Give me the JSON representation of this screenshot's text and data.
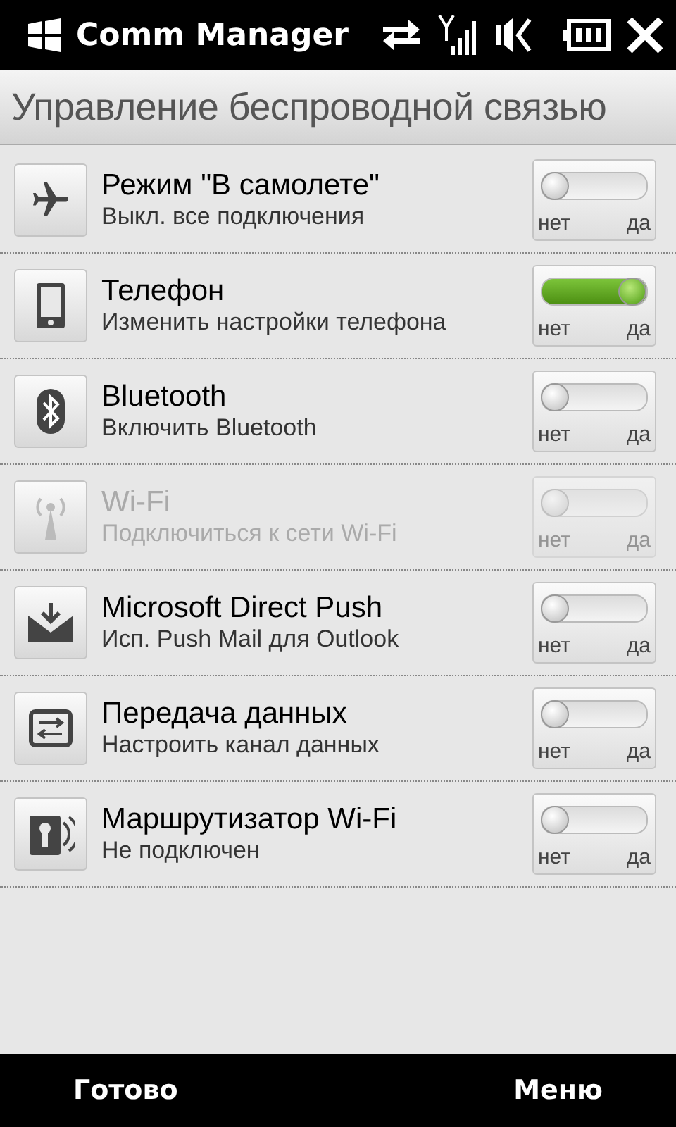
{
  "title_bar": {
    "title": "Comm Manager"
  },
  "heading": "Управление беспроводной связью",
  "items": [
    {
      "kind": "airplane",
      "title": "Режим \"В самолете\"",
      "subtitle": "Выкл. все подключения",
      "on": false,
      "disabled": false,
      "off_label": "нет",
      "on_label": "да"
    },
    {
      "kind": "phone",
      "title": "Телефон",
      "subtitle": "Изменить настройки телефона",
      "on": true,
      "disabled": false,
      "off_label": "нет",
      "on_label": "да"
    },
    {
      "kind": "bluetooth",
      "title": "Bluetooth",
      "subtitle": "Включить Bluetooth",
      "on": false,
      "disabled": false,
      "off_label": "нет",
      "on_label": "да"
    },
    {
      "kind": "antenna",
      "title": "Wi-Fi",
      "subtitle": "Подключиться к сети Wi-Fi",
      "on": false,
      "disabled": true,
      "off_label": "нет",
      "on_label": "да"
    },
    {
      "kind": "mail",
      "title": "Microsoft Direct Push",
      "subtitle": "Исп. Push Mail для Outlook",
      "on": false,
      "disabled": false,
      "off_label": "нет",
      "on_label": "да"
    },
    {
      "kind": "transfer",
      "title": "Передача данных",
      "subtitle": "Настроить канал данных",
      "on": false,
      "disabled": false,
      "off_label": "нет",
      "on_label": "да"
    },
    {
      "kind": "router",
      "title": "Маршрутизатор Wi-Fi",
      "subtitle": "Не подключен",
      "on": false,
      "disabled": false,
      "off_label": "нет",
      "on_label": "да"
    }
  ],
  "softkeys": [
    "Готово",
    "Меню"
  ]
}
